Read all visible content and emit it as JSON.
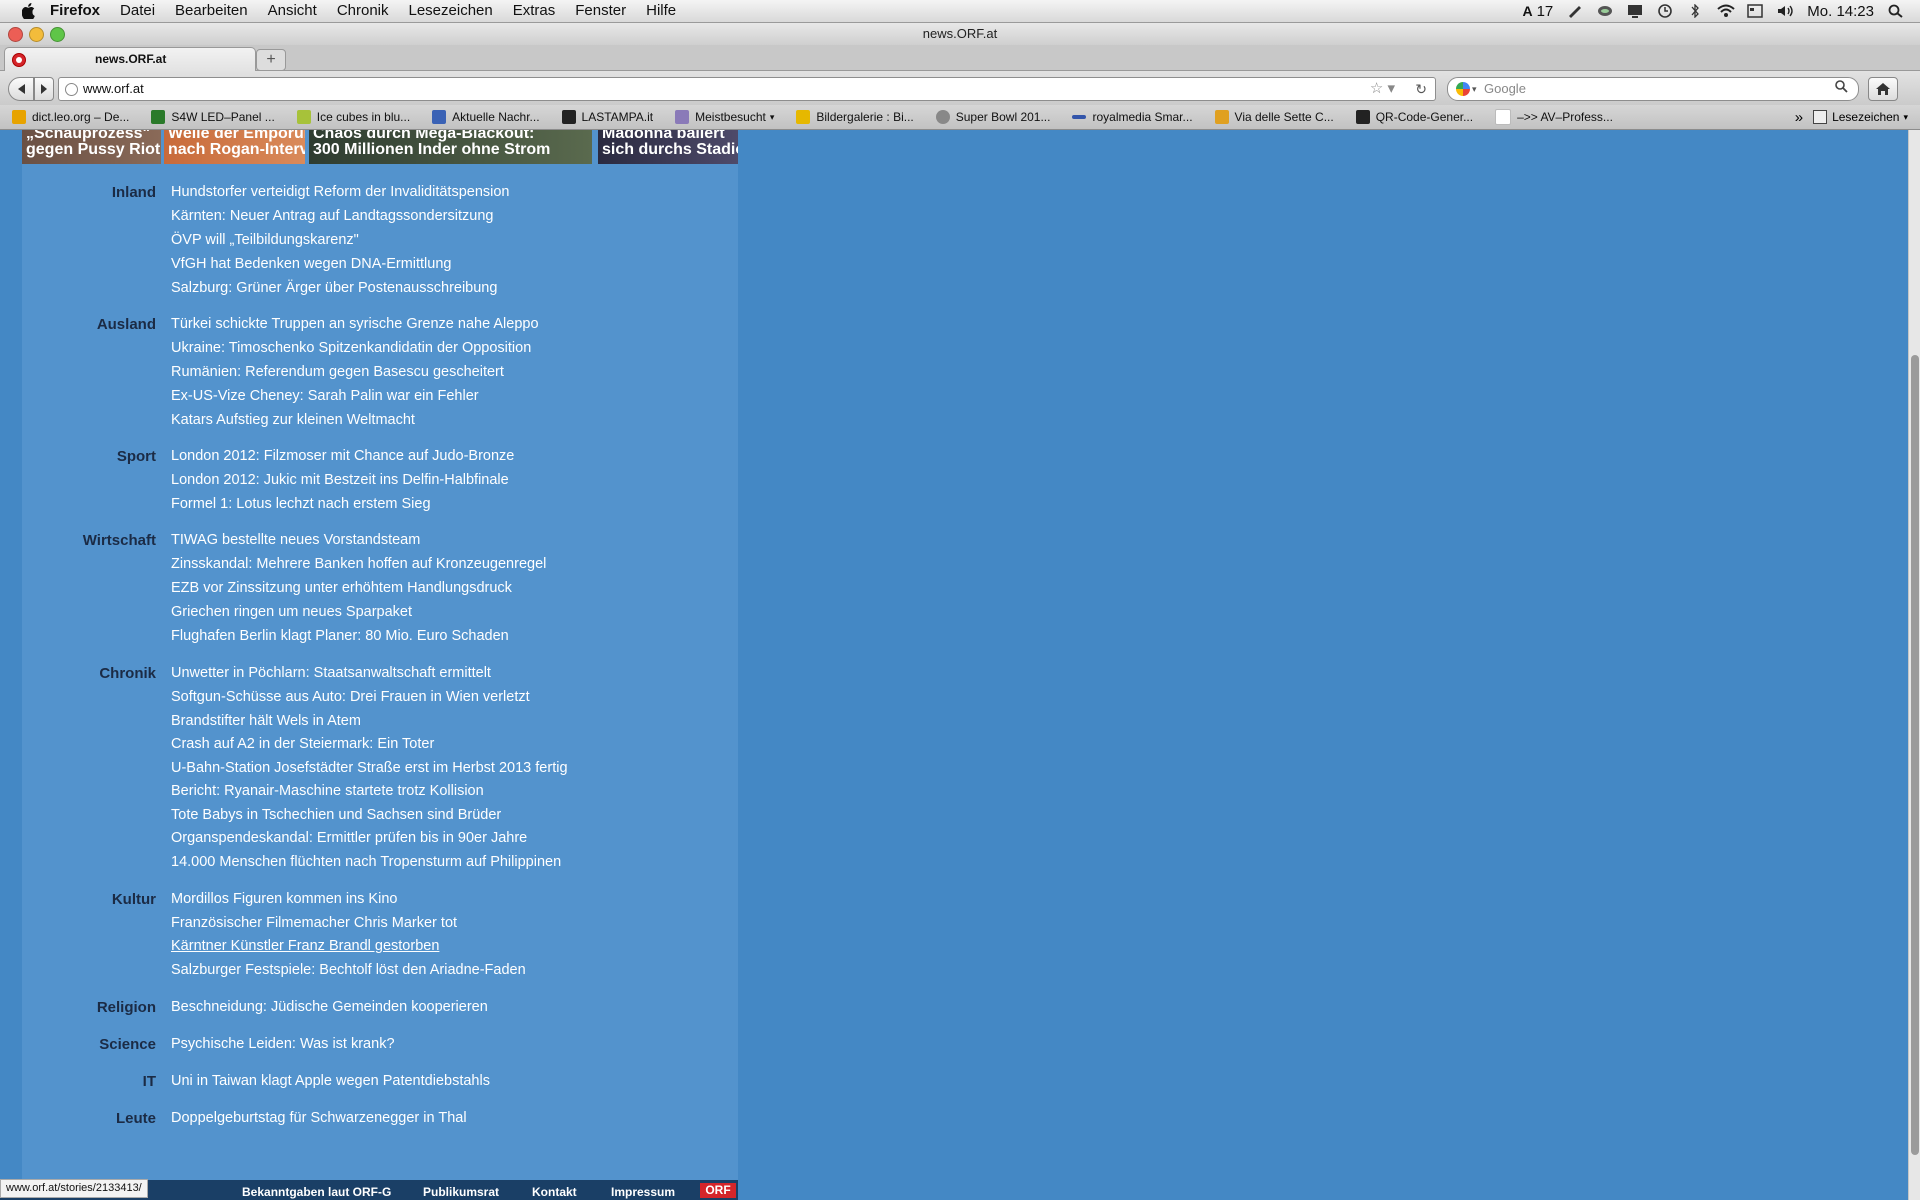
{
  "menubar": {
    "items": [
      "Firefox",
      "Datei",
      "Bearbeiten",
      "Ansicht",
      "Chronik",
      "Lesezeichen",
      "Extras",
      "Fenster",
      "Hilfe"
    ],
    "status_badge": "17",
    "clock": "Mo. 14:23"
  },
  "window": {
    "title": "news.ORF.at"
  },
  "tab": {
    "title": "news.ORF.at",
    "new_tab_symbol": "+"
  },
  "nav": {
    "url": "www.orf.at",
    "search_placeholder": "Google"
  },
  "bookmarks": {
    "items": [
      {
        "label": "dict.leo.org – De...",
        "color": "#e7a300"
      },
      {
        "label": "S4W LED–Panel ...",
        "color": "#2a7a2a"
      },
      {
        "label": "Ice cubes in blu...",
        "color": "#a7c23a"
      },
      {
        "label": "Aktuelle Nachr...",
        "color": "#3a62b5"
      },
      {
        "label": "LASTAMPA.it",
        "color": "#222222"
      },
      {
        "label": "Meistbesucht",
        "color": "#8a7ab8"
      },
      {
        "label": "Bildergalerie : Bi...",
        "color": "#e6b800"
      },
      {
        "label": "Super Bowl 201...",
        "color": "#888888"
      },
      {
        "label": "royalmedia Smar...",
        "color": "#3355aa"
      },
      {
        "label": "Via delle Sette C...",
        "color": "#e0a020"
      },
      {
        "label": "QR-Code-Gener...",
        "color": "#222222"
      },
      {
        "label": "–>> AV–Profess...",
        "color": "#bbbbbb"
      }
    ],
    "overflow": "»",
    "folder": "Lesezeichen"
  },
  "teasers": {
    "t1": [
      "„Schauprozess\"",
      "gegen Pussy Riot"
    ],
    "t2": [
      "Welle der Empörung",
      "nach Rogan-Interview"
    ],
    "t3": [
      "Chaos durch Mega-Blackout:",
      "300 Millionen Inder ohne Strom"
    ],
    "t4": [
      "Madonna ballert",
      "sich durchs Stadion"
    ]
  },
  "sections": {
    "inland": {
      "label": "Inland",
      "items": [
        "Hundstorfer verteidigt Reform der Invaliditätspension",
        "Kärnten: Neuer Antrag auf Landtagssondersitzung",
        "ÖVP will „Teilbildungskarenz\"",
        "VfGH hat Bedenken wegen DNA-Ermittlung",
        "Salzburg: Grüner Ärger über Postenausschreibung"
      ]
    },
    "ausland": {
      "label": "Ausland",
      "items": [
        "Türkei schickte Truppen an syrische Grenze nahe Aleppo",
        "Ukraine: Timoschenko Spitzenkandidatin der Opposition",
        "Rumänien: Referendum gegen Basescu gescheitert",
        "Ex-US-Vize Cheney: Sarah Palin war ein Fehler",
        "Katars Aufstieg zur kleinen Weltmacht"
      ]
    },
    "sport": {
      "label": "Sport",
      "items": [
        "London 2012: Filzmoser mit Chance auf Judo-Bronze",
        "London 2012: Jukic mit Bestzeit ins Delfin-Halbfinale",
        "Formel 1: Lotus lechzt nach erstem Sieg"
      ]
    },
    "wirtschaft": {
      "label": "Wirtschaft",
      "items": [
        "TIWAG bestellte neues Vorstandsteam",
        "Zinsskandal: Mehrere Banken hoffen auf Kronzeugenregel",
        "EZB vor Zinssitzung unter erhöhtem Handlungsdruck",
        "Griechen ringen um neues Sparpaket",
        "Flughafen Berlin klagt Planer: 80 Mio. Euro Schaden"
      ]
    },
    "chronik": {
      "label": "Chronik",
      "items": [
        "Unwetter in Pöchlarn: Staatsanwaltschaft ermittelt",
        "Softgun-Schüsse aus Auto: Drei Frauen in Wien verletzt",
        "Brandstifter hält Wels in Atem",
        "Crash auf A2 in der Steiermark: Ein Toter",
        "U-Bahn-Station Josefstädter Straße erst im Herbst 2013 fertig",
        "Bericht: Ryanair-Maschine startete trotz Kollision",
        "Tote Babys in Tschechien und Sachsen sind Brüder",
        "Organspendeskandal: Ermittler prüfen bis in 90er Jahre",
        "14.000 Menschen flüchten nach Tropensturm auf Philippinen"
      ]
    },
    "kultur": {
      "label": "Kultur",
      "items": [
        "Mordillos Figuren kommen ins Kino",
        "Französischer Filmemacher Chris Marker tot",
        "Kärntner Künstler Franz Brandl gestorben",
        "Salzburger Festspiele: Bechtolf löst den Ariadne-Faden"
      ]
    },
    "religion": {
      "label": "Religion",
      "items": [
        "Beschneidung: Jüdische Gemeinden kooperieren"
      ]
    },
    "science": {
      "label": "Science",
      "items": [
        "Psychische Leiden: Was ist krank?"
      ]
    },
    "it": {
      "label": "IT",
      "items": [
        "Uni in Taiwan klagt Apple wegen Patentdiebstahls"
      ]
    },
    "leute": {
      "label": "Leute",
      "items": [
        "Doppelgeburtstag für Schwarzenegger in Thal"
      ]
    }
  },
  "footer": {
    "links": [
      "Bekanntgaben laut ORF-G",
      "Publikumsrat",
      "Kontakt",
      "Impressum"
    ],
    "logo": "ORF"
  },
  "statusbar": {
    "url": "www.orf.at/stories/2133413/"
  }
}
